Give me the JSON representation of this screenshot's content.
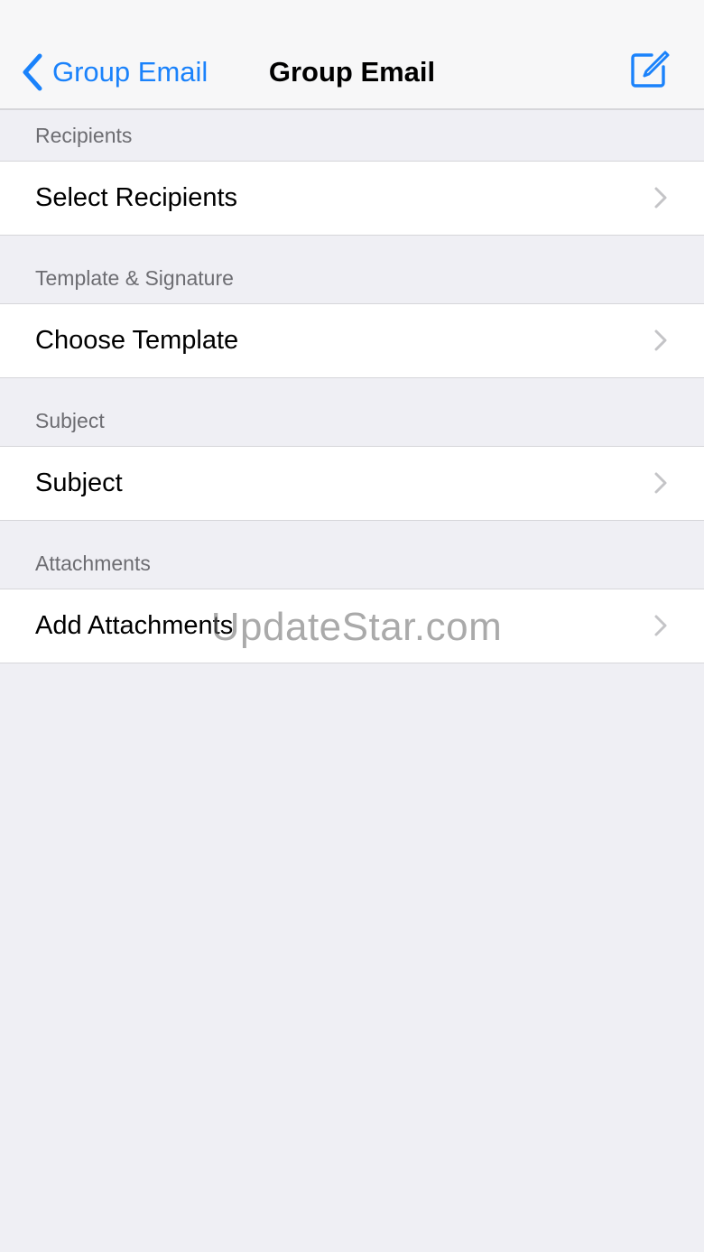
{
  "nav": {
    "back_label": "Group Email",
    "title": "Group Email",
    "back_icon": "chevron-left-icon",
    "compose_icon": "compose-icon"
  },
  "sections": [
    {
      "header": "Recipients",
      "row_label": "Select Recipients"
    },
    {
      "header": "Template & Signature",
      "row_label": "Choose Template"
    },
    {
      "header": "Subject",
      "row_label": "Subject"
    },
    {
      "header": "Attachments",
      "row_label": "Add Attachments"
    }
  ],
  "watermark": "UpdateStar.com",
  "colors": {
    "accent": "#1a82fb",
    "background": "#efeff4",
    "section_header_text": "#6d6d72",
    "separator": "#d6d6da",
    "chevron": "#c4c4c7"
  }
}
